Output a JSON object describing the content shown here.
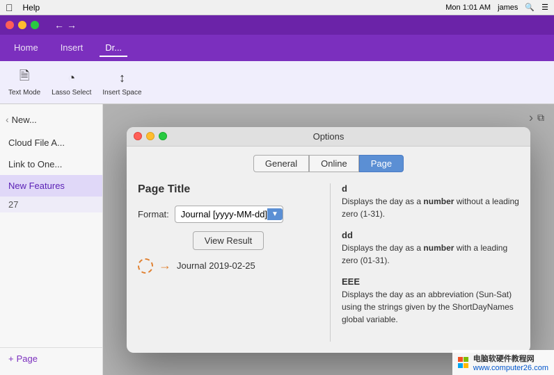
{
  "menubar": {
    "left": [
      "Help"
    ],
    "time": "Mon 1:01 AM",
    "user": "james"
  },
  "app": {
    "tabs": [
      {
        "id": "home",
        "label": "Home",
        "active": false
      },
      {
        "id": "insert",
        "label": "Insert",
        "active": false
      },
      {
        "id": "draw",
        "label": "Dr...",
        "active": true
      }
    ],
    "ribbon": {
      "buttons": [
        {
          "id": "text-mode",
          "label": "Text Mode"
        },
        {
          "id": "lasso-select",
          "label": "Lasso Select"
        },
        {
          "id": "insert-space",
          "label": "Insert Space"
        }
      ]
    }
  },
  "sidebar": {
    "search_placeholder": "New...",
    "items": [
      {
        "id": "cloud-file",
        "label": "Cloud File A..."
      },
      {
        "id": "link-to-one",
        "label": "Link to One..."
      },
      {
        "id": "new-features",
        "label": "New Features",
        "active": true
      },
      {
        "id": "page-num",
        "label": "27"
      }
    ],
    "add_page_label": "+ Page"
  },
  "dialog": {
    "title": "Options",
    "tabs": [
      {
        "id": "general",
        "label": "General"
      },
      {
        "id": "online",
        "label": "Online"
      },
      {
        "id": "page",
        "label": "Page",
        "active": true
      }
    ],
    "section_title": "Page Title",
    "format_label": "Format:",
    "format_value": "Journal [yyyy-MM-dd]",
    "view_result_btn": "View Result",
    "preview_text": "Journal 2019-02-25",
    "help_entries": [
      {
        "code": "d",
        "desc_before": "Displays the day as a ",
        "desc_bold": "number",
        "desc_after": " without a leading zero (1-31)."
      },
      {
        "code": "dd",
        "desc_before": "Displays the day as a ",
        "desc_bold": "number",
        "desc_after": " with a leading zero (01-31)."
      },
      {
        "code": "EEE",
        "desc_before": "Displays the day as an abbreviation (Sun-Sat) using the strings given by the ShortDayNames global variable.",
        "desc_bold": "",
        "desc_after": ""
      }
    ]
  },
  "watermark": {
    "site1": "电脑软硬件教程网",
    "site2": "www.computer26.com"
  }
}
